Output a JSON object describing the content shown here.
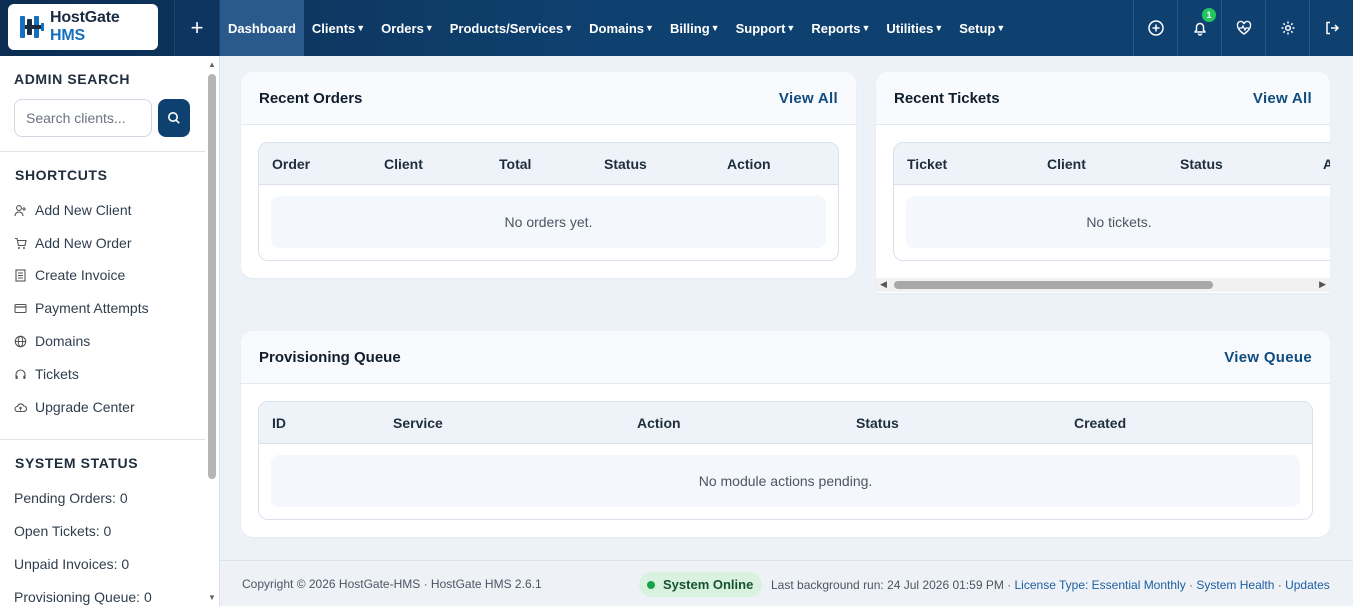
{
  "brand": {
    "name_main": "HostGate",
    "name_accent": "HMS"
  },
  "topbar": {
    "quick_add": "+",
    "nav": [
      {
        "label": "Dashboard",
        "dropdown": false,
        "active": true
      },
      {
        "label": "Clients",
        "dropdown": true
      },
      {
        "label": "Orders",
        "dropdown": true
      },
      {
        "label": "Products/Services",
        "dropdown": true
      },
      {
        "label": "Domains",
        "dropdown": true
      },
      {
        "label": "Billing",
        "dropdown": true
      },
      {
        "label": "Support",
        "dropdown": true
      },
      {
        "label": "Reports",
        "dropdown": true
      },
      {
        "label": "Utilities",
        "dropdown": true
      },
      {
        "label": "Setup",
        "dropdown": true
      }
    ],
    "icons": [
      "add-circle-icon",
      "bell-icon",
      "health-icon",
      "gear-icon",
      "logout-icon"
    ],
    "notification_count": "1"
  },
  "sidebar": {
    "search_heading": "ADMIN SEARCH",
    "search_placeholder": "Search clients...",
    "shortcuts_heading": "SHORTCUTS",
    "shortcuts": [
      {
        "label": "Add New Client",
        "icon": "user-plus-icon"
      },
      {
        "label": "Add New Order",
        "icon": "cart-icon"
      },
      {
        "label": "Create Invoice",
        "icon": "invoice-icon"
      },
      {
        "label": "Payment Attempts",
        "icon": "credit-card-icon"
      },
      {
        "label": "Domains",
        "icon": "globe-icon"
      },
      {
        "label": "Tickets",
        "icon": "headset-icon"
      },
      {
        "label": "Upgrade Center",
        "icon": "cloud-upload-icon"
      }
    ],
    "status_heading": "SYSTEM STATUS",
    "status": [
      "Pending Orders: 0",
      "Open Tickets: 0",
      "Unpaid Invoices: 0",
      "Provisioning Queue: 0"
    ]
  },
  "recent_orders": {
    "title": "Recent Orders",
    "link": "View All",
    "columns": [
      "Order",
      "Client",
      "Total",
      "Status",
      "Action"
    ],
    "empty": "No orders yet."
  },
  "recent_tickets": {
    "title": "Recent Tickets",
    "link": "View All",
    "columns": [
      "Ticket",
      "Client",
      "Status",
      "A"
    ],
    "empty": "No tickets."
  },
  "provisioning": {
    "title": "Provisioning Queue",
    "link": "View Queue",
    "columns": [
      "ID",
      "Service",
      "Action",
      "Status",
      "Created"
    ],
    "empty": "No module actions pending."
  },
  "footer": {
    "copyright": "Copyright © 2026 HostGate-HMS · HostGate HMS 2.6.1",
    "online": "System Online",
    "last_run": "Last background run: 24 Jul 2026 01:59 PM",
    "sep": " · ",
    "license": "License Type: Essential Monthly",
    "health": "System Health",
    "updates": "Updates"
  },
  "colors": {
    "nav_bg": "#0f4170",
    "accent": "#0f4c81",
    "online": "#16a34a"
  }
}
